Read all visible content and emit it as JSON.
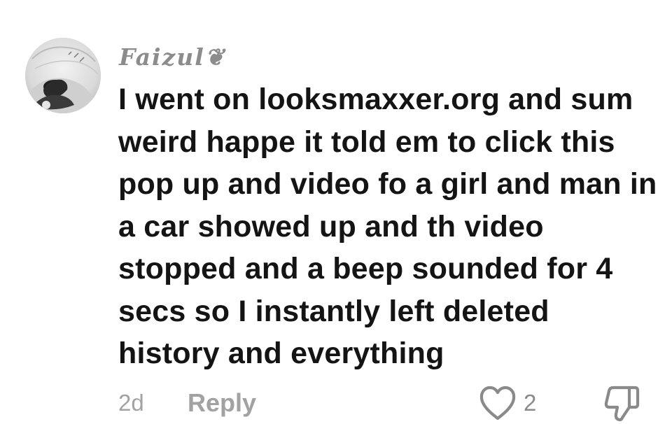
{
  "comment": {
    "username": "Faizul❦",
    "text": "I went on looksmaxxer.org and sum weird happe it told em to click this pop up and video fo a girl and man in a car showed up and th video stopped and a beep sounded for 4 secs so I instantly left deleted history and everything",
    "timestamp": "2d",
    "reply_label": "Reply",
    "like_count": "2"
  },
  "icons": {
    "avatar": "profile-avatar",
    "like": "heart-icon",
    "dislike": "thumbs-down-icon"
  },
  "colors": {
    "text": "#141414",
    "muted": "#a2a2a2",
    "icon": "#8a8a8a"
  }
}
